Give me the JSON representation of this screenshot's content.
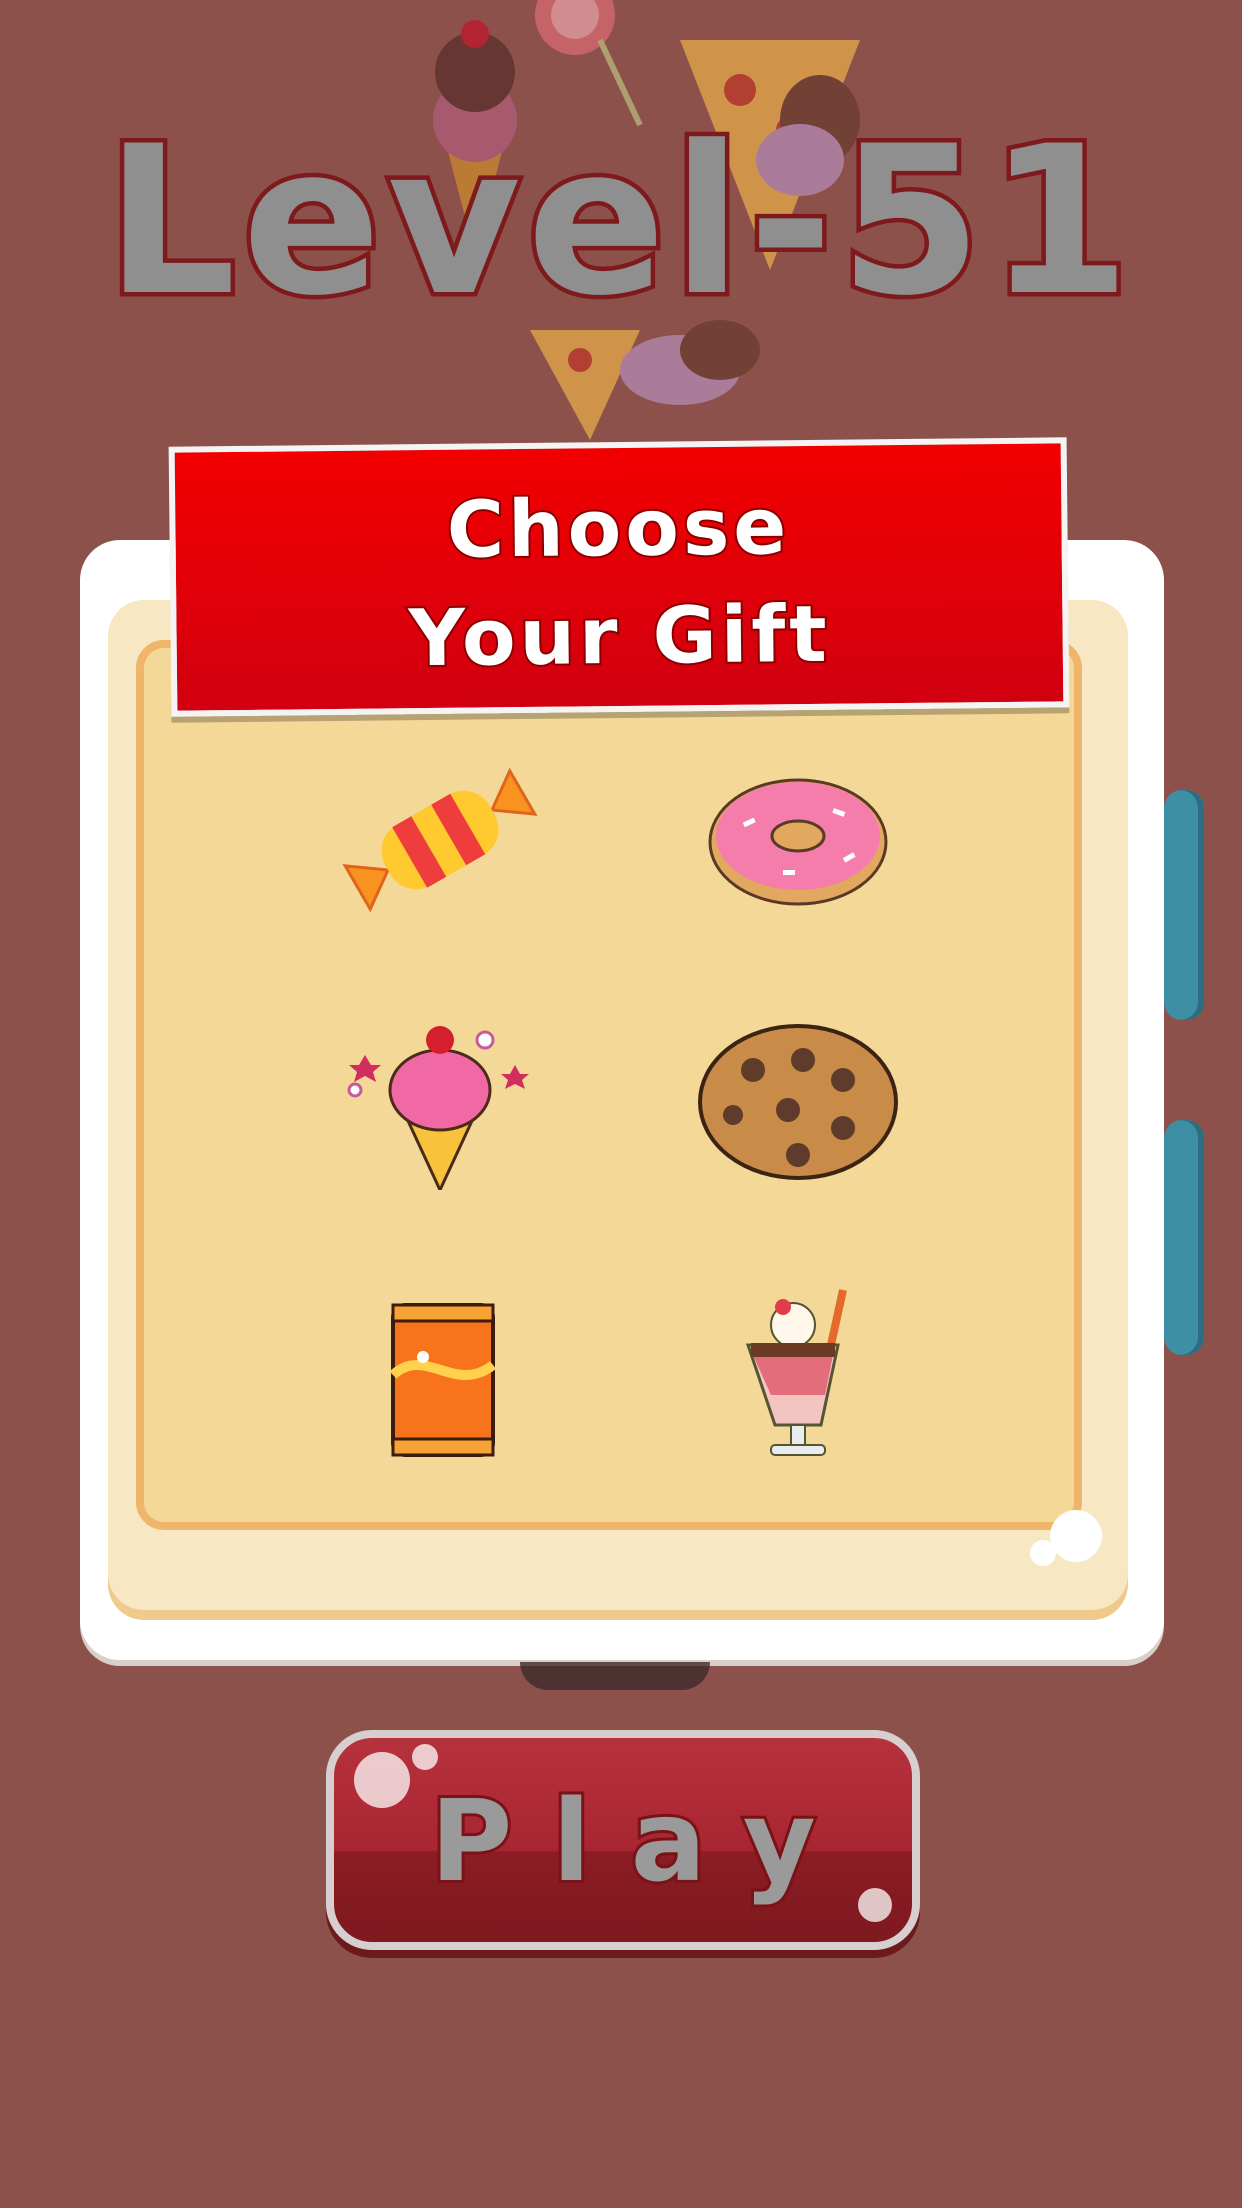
{
  "level": {
    "title": "Level-51"
  },
  "gift_panel": {
    "title_line1": "Choose",
    "title_line2": "Your Gift",
    "gifts": [
      {
        "name": "candy-icon"
      },
      {
        "name": "donut-icon"
      },
      {
        "name": "ice-cream-icon"
      },
      {
        "name": "cookie-icon"
      },
      {
        "name": "soda-can-icon"
      },
      {
        "name": "milkshake-icon"
      }
    ]
  },
  "play_button": {
    "label": "Play"
  },
  "colors": {
    "background": "#8d514c",
    "ribbon": "#e8000a",
    "panel": "#f4d898",
    "play": "#a82532"
  }
}
